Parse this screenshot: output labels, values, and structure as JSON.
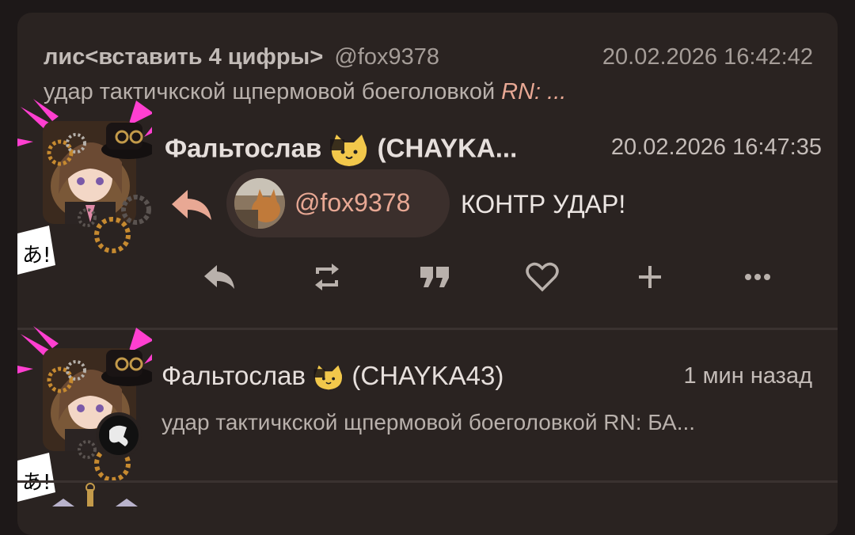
{
  "quoted": {
    "display_name": "лис<вставить 4 цифры>",
    "handle": "@fox9378",
    "timestamp": "20.02.2026 16:42:42",
    "preview": "удар тактичкской щпермовой боеголовкой",
    "preview_tag": "RN: ..."
  },
  "reply": {
    "display_name": "Фальтослав",
    "handle": "(CHAYKA...",
    "timestamp": "20.02.2026 16:47:35",
    "mention": "@fox9378",
    "text": "КОНТР УДАР!"
  },
  "notification": {
    "display_name": "Фальтослав",
    "handle": "(CHAYKA43)",
    "time_ago": "1 мин назад",
    "preview": "удар тактичкской щпермовой боеголовкой RN: БА..."
  },
  "colors": {
    "background": "#1d1818",
    "card": "#2a2321",
    "accent": "#e8a894",
    "text": "#e6dfdc",
    "muted": "#a59d98"
  },
  "icons": [
    "reply-icon",
    "renote-icon",
    "quote-icon",
    "heart-icon",
    "plus-icon",
    "more-icon",
    "cat-emoji-icon"
  ]
}
